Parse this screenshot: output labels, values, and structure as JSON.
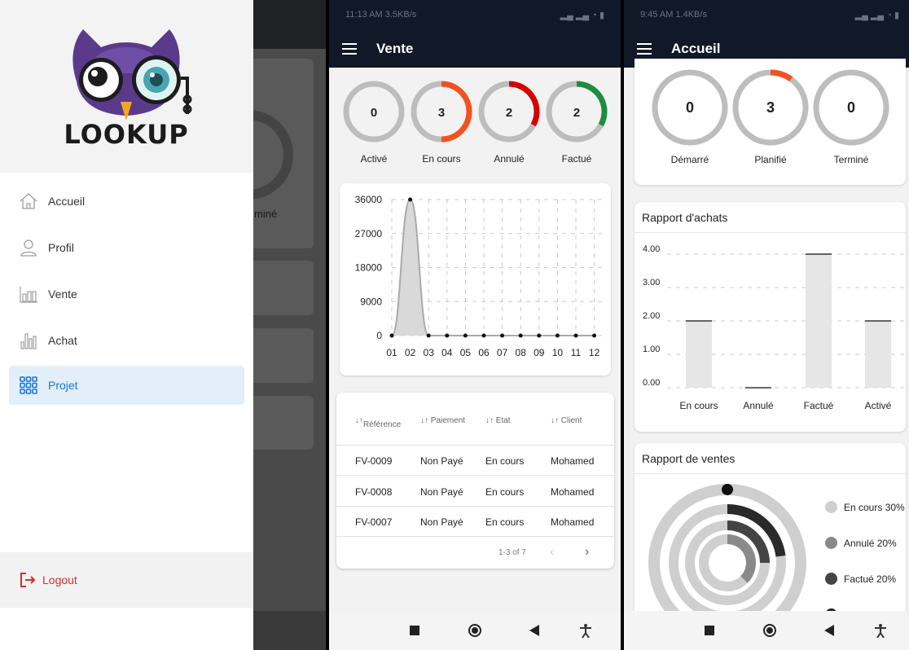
{
  "drawer": {
    "brand": "LOOKUP",
    "items": [
      {
        "label": "Accueil",
        "icon": "home-icon"
      },
      {
        "label": "Profil",
        "icon": "user-icon"
      },
      {
        "label": "Vente",
        "icon": "sales-chart-icon"
      },
      {
        "label": "Achat",
        "icon": "purchase-chart-icon"
      },
      {
        "label": "Projet",
        "icon": "grid-icon",
        "active": true
      }
    ],
    "logout": "Logout",
    "background_fragment": "miné",
    "colors": {
      "active_bg": "#e3eefb",
      "active_text": "#1976d2",
      "logout": "#d32f2f"
    }
  },
  "vente": {
    "status": {
      "time": "11:13 AM",
      "speed": "3.5KB/s"
    },
    "title": "Vente",
    "rings": [
      {
        "value": "0",
        "label": "Activé",
        "color": "#e65100",
        "fraction": 0
      },
      {
        "value": "3",
        "label": "En cours",
        "color": "#f4511e",
        "fraction": 0.5
      },
      {
        "value": "2",
        "label": "Annulé",
        "color": "#d50000",
        "fraction": 0.33
      },
      {
        "value": "2",
        "label": "Factué",
        "color": "#1e8e3e",
        "fraction": 0.33
      }
    ],
    "table": {
      "headers": [
        "Référence",
        "Paiement",
        "Etat",
        "Client"
      ],
      "rows": [
        [
          "FV-0009",
          "Non Payé",
          "En cours",
          "Mohamed"
        ],
        [
          "FV-0008",
          "Non Payé",
          "En cours",
          "Mohamed"
        ],
        [
          "FV-0007",
          "Non Payé",
          "En cours",
          "Mohamed"
        ]
      ],
      "pagination": "1-3 of 7"
    }
  },
  "accueil": {
    "status": {
      "time": "9:45 AM",
      "speed": "1.4KB/s"
    },
    "title": "Accueil",
    "rings": [
      {
        "value": "0",
        "label": "Démarré",
        "color": "#bdbdbd",
        "fraction": 0
      },
      {
        "value": "3",
        "label": "Planifié",
        "color": "#f4511e",
        "fraction": 0.1
      },
      {
        "value": "0",
        "label": "Terminé",
        "color": "#bdbdbd",
        "fraction": 0
      }
    ],
    "achats_title": "Rapport d'achats",
    "ventes_title": "Rapport de ventes",
    "legend": [
      {
        "label": "En cours 30%",
        "color": "#cfcfcf"
      },
      {
        "label": "Annulé 20%",
        "color": "#8a8a8a"
      },
      {
        "label": "Factué 20%",
        "color": "#444444"
      }
    ]
  },
  "chart_data": [
    {
      "type": "area",
      "title": "",
      "categories": [
        "01",
        "02",
        "03",
        "04",
        "05",
        "06",
        "07",
        "08",
        "09",
        "10",
        "11",
        "12"
      ],
      "values": [
        0,
        36000,
        0,
        0,
        0,
        0,
        0,
        0,
        0,
        0,
        0,
        0
      ],
      "yticks": [
        "0",
        "9000",
        "18000",
        "27000",
        "36000"
      ],
      "ylim": [
        0,
        36000
      ],
      "grid": true
    },
    {
      "type": "bar",
      "title": "Rapport d'achats",
      "categories": [
        "En cours",
        "Annulé",
        "Factué",
        "Activé"
      ],
      "values": [
        2,
        0,
        4,
        2
      ],
      "yticks": [
        "0.00",
        "1.00",
        "2.00",
        "3.00",
        "4.00"
      ],
      "ylim": [
        0,
        4
      ],
      "grid": true
    },
    {
      "type": "pie",
      "title": "Rapport de ventes",
      "categories": [
        "En cours",
        "Annulé",
        "Factué"
      ],
      "values": [
        30,
        20,
        20
      ]
    }
  ]
}
